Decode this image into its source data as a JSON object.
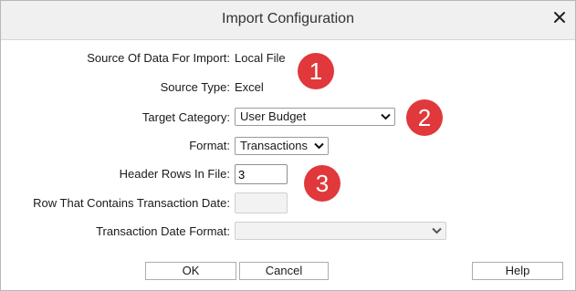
{
  "dialog": {
    "title": "Import Configuration",
    "close_icon": "close-icon"
  },
  "fields": {
    "source_label": "Source Of Data For Import:",
    "source_value": "Local File",
    "type_label": "Source Type:",
    "type_value": "Excel",
    "category_label": "Target Category:",
    "category_value": "User Budget",
    "format_label": "Format:",
    "format_value": "Transactions",
    "header_rows_label": "Header Rows In File:",
    "header_rows_value": "3",
    "date_row_label": "Row That Contains Transaction Date:",
    "date_row_value": "",
    "date_format_label": "Transaction Date Format:",
    "date_format_value": ""
  },
  "badges": [
    "1",
    "2",
    "3"
  ],
  "buttons": {
    "ok": "OK",
    "cancel": "Cancel",
    "help": "Help"
  },
  "colors": {
    "badge": "#e0383b",
    "titlebar": "#f0f0f0"
  }
}
